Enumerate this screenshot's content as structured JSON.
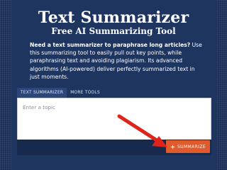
{
  "header": {
    "title": "Text Summarizer",
    "subtitle": "Free AI Summarizing Tool"
  },
  "intro": {
    "bold": "Need a text summarizer to paraphrase long articles?",
    "text": " Use this summarizing tool to easily pull out key points, while paraphrasing text and avoiding plagiarism. Its advanced algorithms (AI-powered) deliver perfectly summarized text in just moments."
  },
  "tabs": [
    {
      "label": "TEXT SUMMARIZER",
      "active": true
    },
    {
      "label": "MORE TOOLS",
      "active": false
    }
  ],
  "editor": {
    "placeholder": "Enter a topic"
  },
  "summarize_button": {
    "label": "SUMMARIZE",
    "icon": "sparkle-icon"
  },
  "colors": {
    "background": "#1b2f57",
    "accent": "#e15a2c",
    "arrow": "#e0231b"
  }
}
